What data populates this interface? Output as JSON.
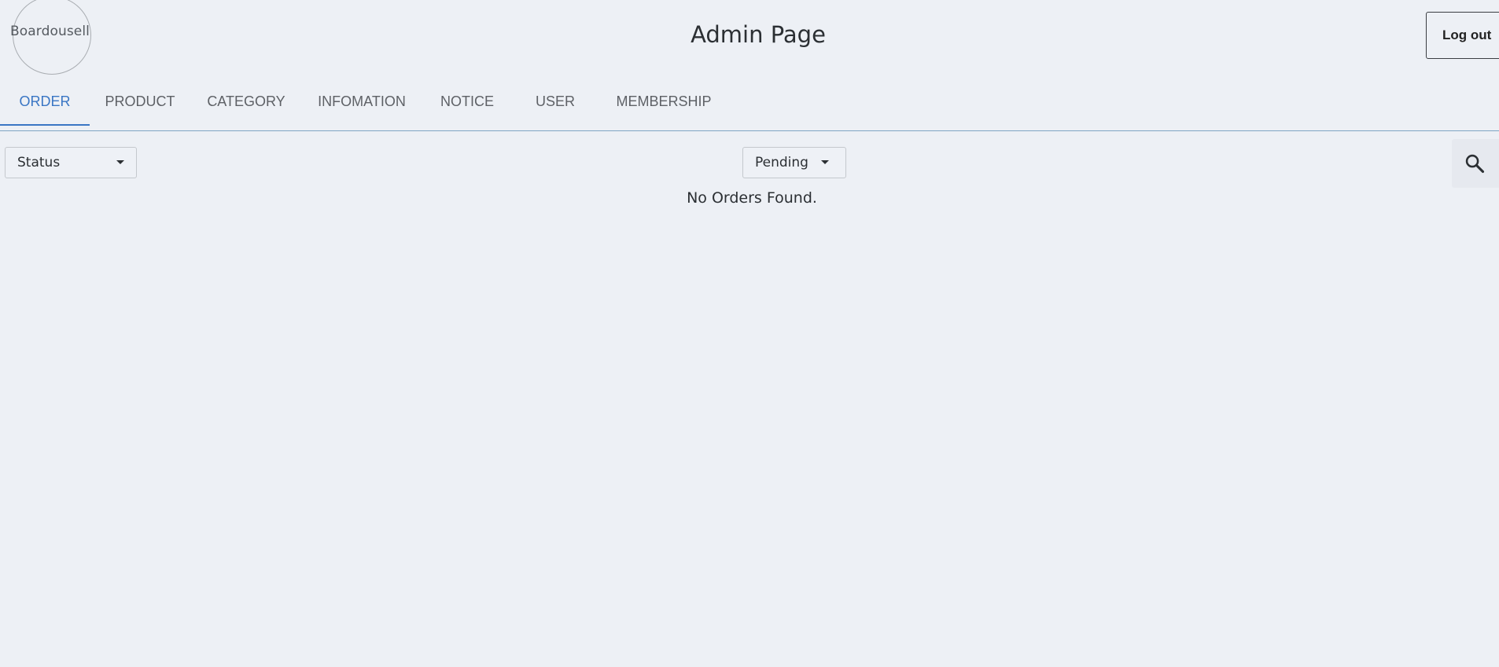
{
  "header": {
    "logo_text": "Boardousell",
    "title": "Admin Page",
    "logout_label": "Log out"
  },
  "tabs": [
    {
      "label": "ORDER",
      "active": true
    },
    {
      "label": "PRODUCT",
      "active": false
    },
    {
      "label": "CATEGORY",
      "active": false
    },
    {
      "label": "INFOMATION",
      "active": false
    },
    {
      "label": "NOTICE",
      "active": false
    },
    {
      "label": "USER",
      "active": false
    },
    {
      "label": "MEMBERSHIP",
      "active": false
    }
  ],
  "filters": {
    "field_selected": "Status",
    "value_selected": "Pending"
  },
  "search": {
    "icon": "search-icon"
  },
  "orders": {
    "empty_message": "No Orders Found."
  },
  "colors": {
    "background": "#edf0f5",
    "accent": "#3a76c4",
    "tab_text": "#5e6166",
    "divider": "#7fa6c3"
  }
}
